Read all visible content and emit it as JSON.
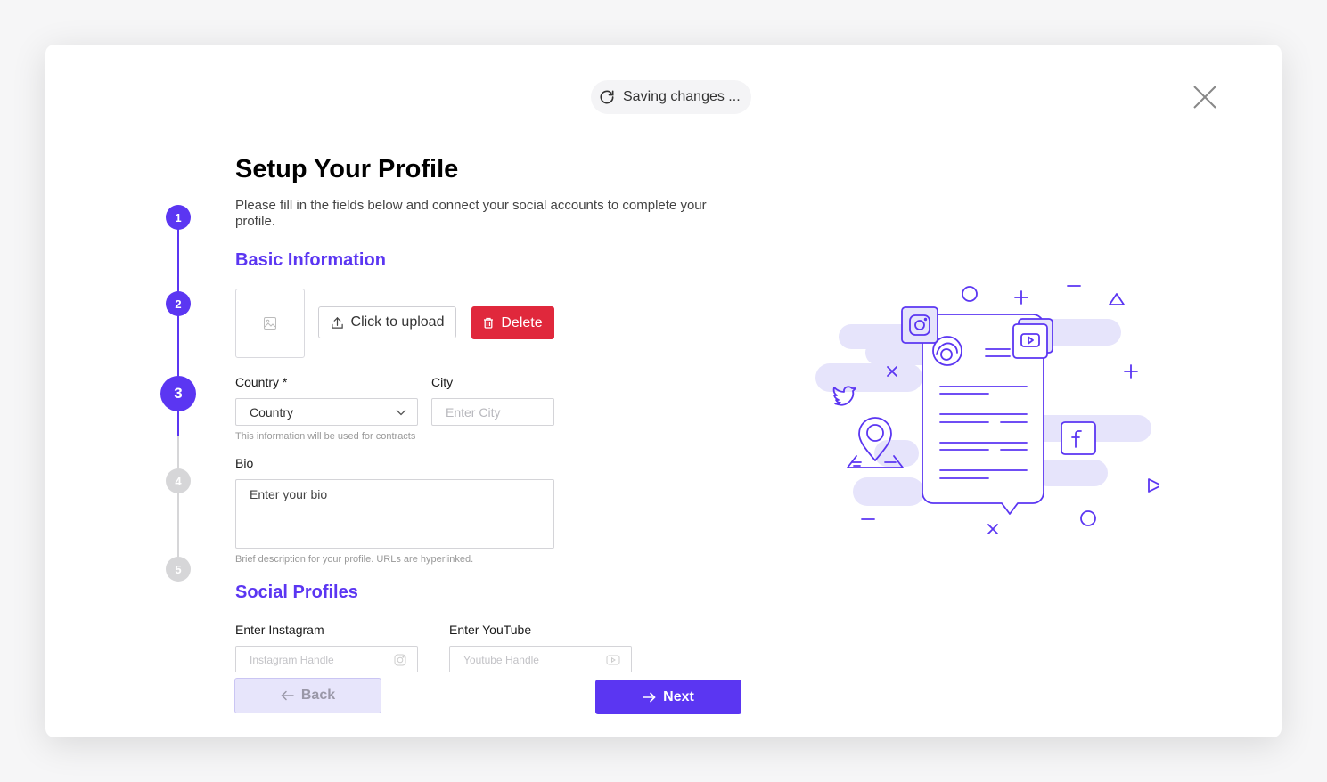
{
  "status": {
    "saving_text": "Saving changes ..."
  },
  "stepper": {
    "steps": [
      "1",
      "2",
      "3",
      "4",
      "5"
    ],
    "current": 3
  },
  "header": {
    "title": "Setup Your Profile",
    "subtitle": "Please fill in the fields below and connect your social accounts to complete your profile."
  },
  "basic": {
    "section_title": "Basic Information",
    "upload_label": "Click to upload",
    "delete_label": "Delete",
    "country_label": "Country *",
    "country_value": "Country",
    "city_label": "City",
    "city_placeholder": "Enter City",
    "contract_help": "This information will be used for contracts",
    "bio_label": "Bio",
    "bio_placeholder": "Enter your bio",
    "bio_help": "Brief description for your profile. URLs are hyperlinked."
  },
  "social": {
    "section_title": "Social Profiles",
    "instagram_label": "Enter Instagram",
    "instagram_placeholder": "Instagram Handle",
    "youtube_label": "Enter YouTube",
    "youtube_placeholder": "Youtube Handle"
  },
  "footer": {
    "back_label": "Back",
    "next_label": "Next"
  },
  "colors": {
    "accent": "#5b36f2",
    "danger": "#e0283c",
    "inactive_step": "#d6d6d8",
    "illustration_cloud": "#e6e4fb"
  }
}
